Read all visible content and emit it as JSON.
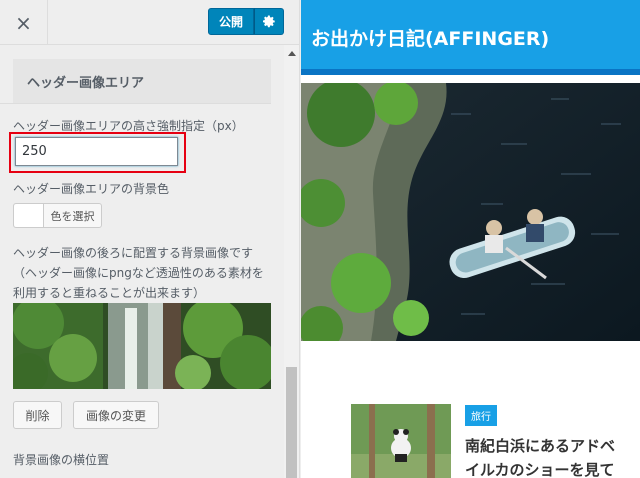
{
  "toolbar": {
    "close_icon": "×",
    "publish_label": "公開",
    "gear_icon": "gear-icon"
  },
  "section": {
    "title": "ヘッダー画像エリア"
  },
  "controls": {
    "height_label": "ヘッダー画像エリアの高さ強制指定（px）",
    "height_value": "250",
    "bg_color_label": "ヘッダー画像エリアの背景色",
    "color_button_label": "色を選択",
    "bg_image_label": "ヘッダー画像の後ろに配置する背景画像です（ヘッダー画像にpngなど透過性のある素材を利用すると重ねることが出来ます）",
    "delete_label": "削除",
    "change_image_label": "画像の変更",
    "h_pos_label": "背景画像の横位置"
  },
  "preview": {
    "site_title": "お出かけ日記(AFFINGER)",
    "post_category": "旅行",
    "post_title_line1": "南紀白浜にあるアドベ",
    "post_title_line2": "イルカのショーを見て"
  },
  "colors": {
    "publish": "#0085ba",
    "header": "#18a0e6",
    "highlight": "#e60012"
  }
}
